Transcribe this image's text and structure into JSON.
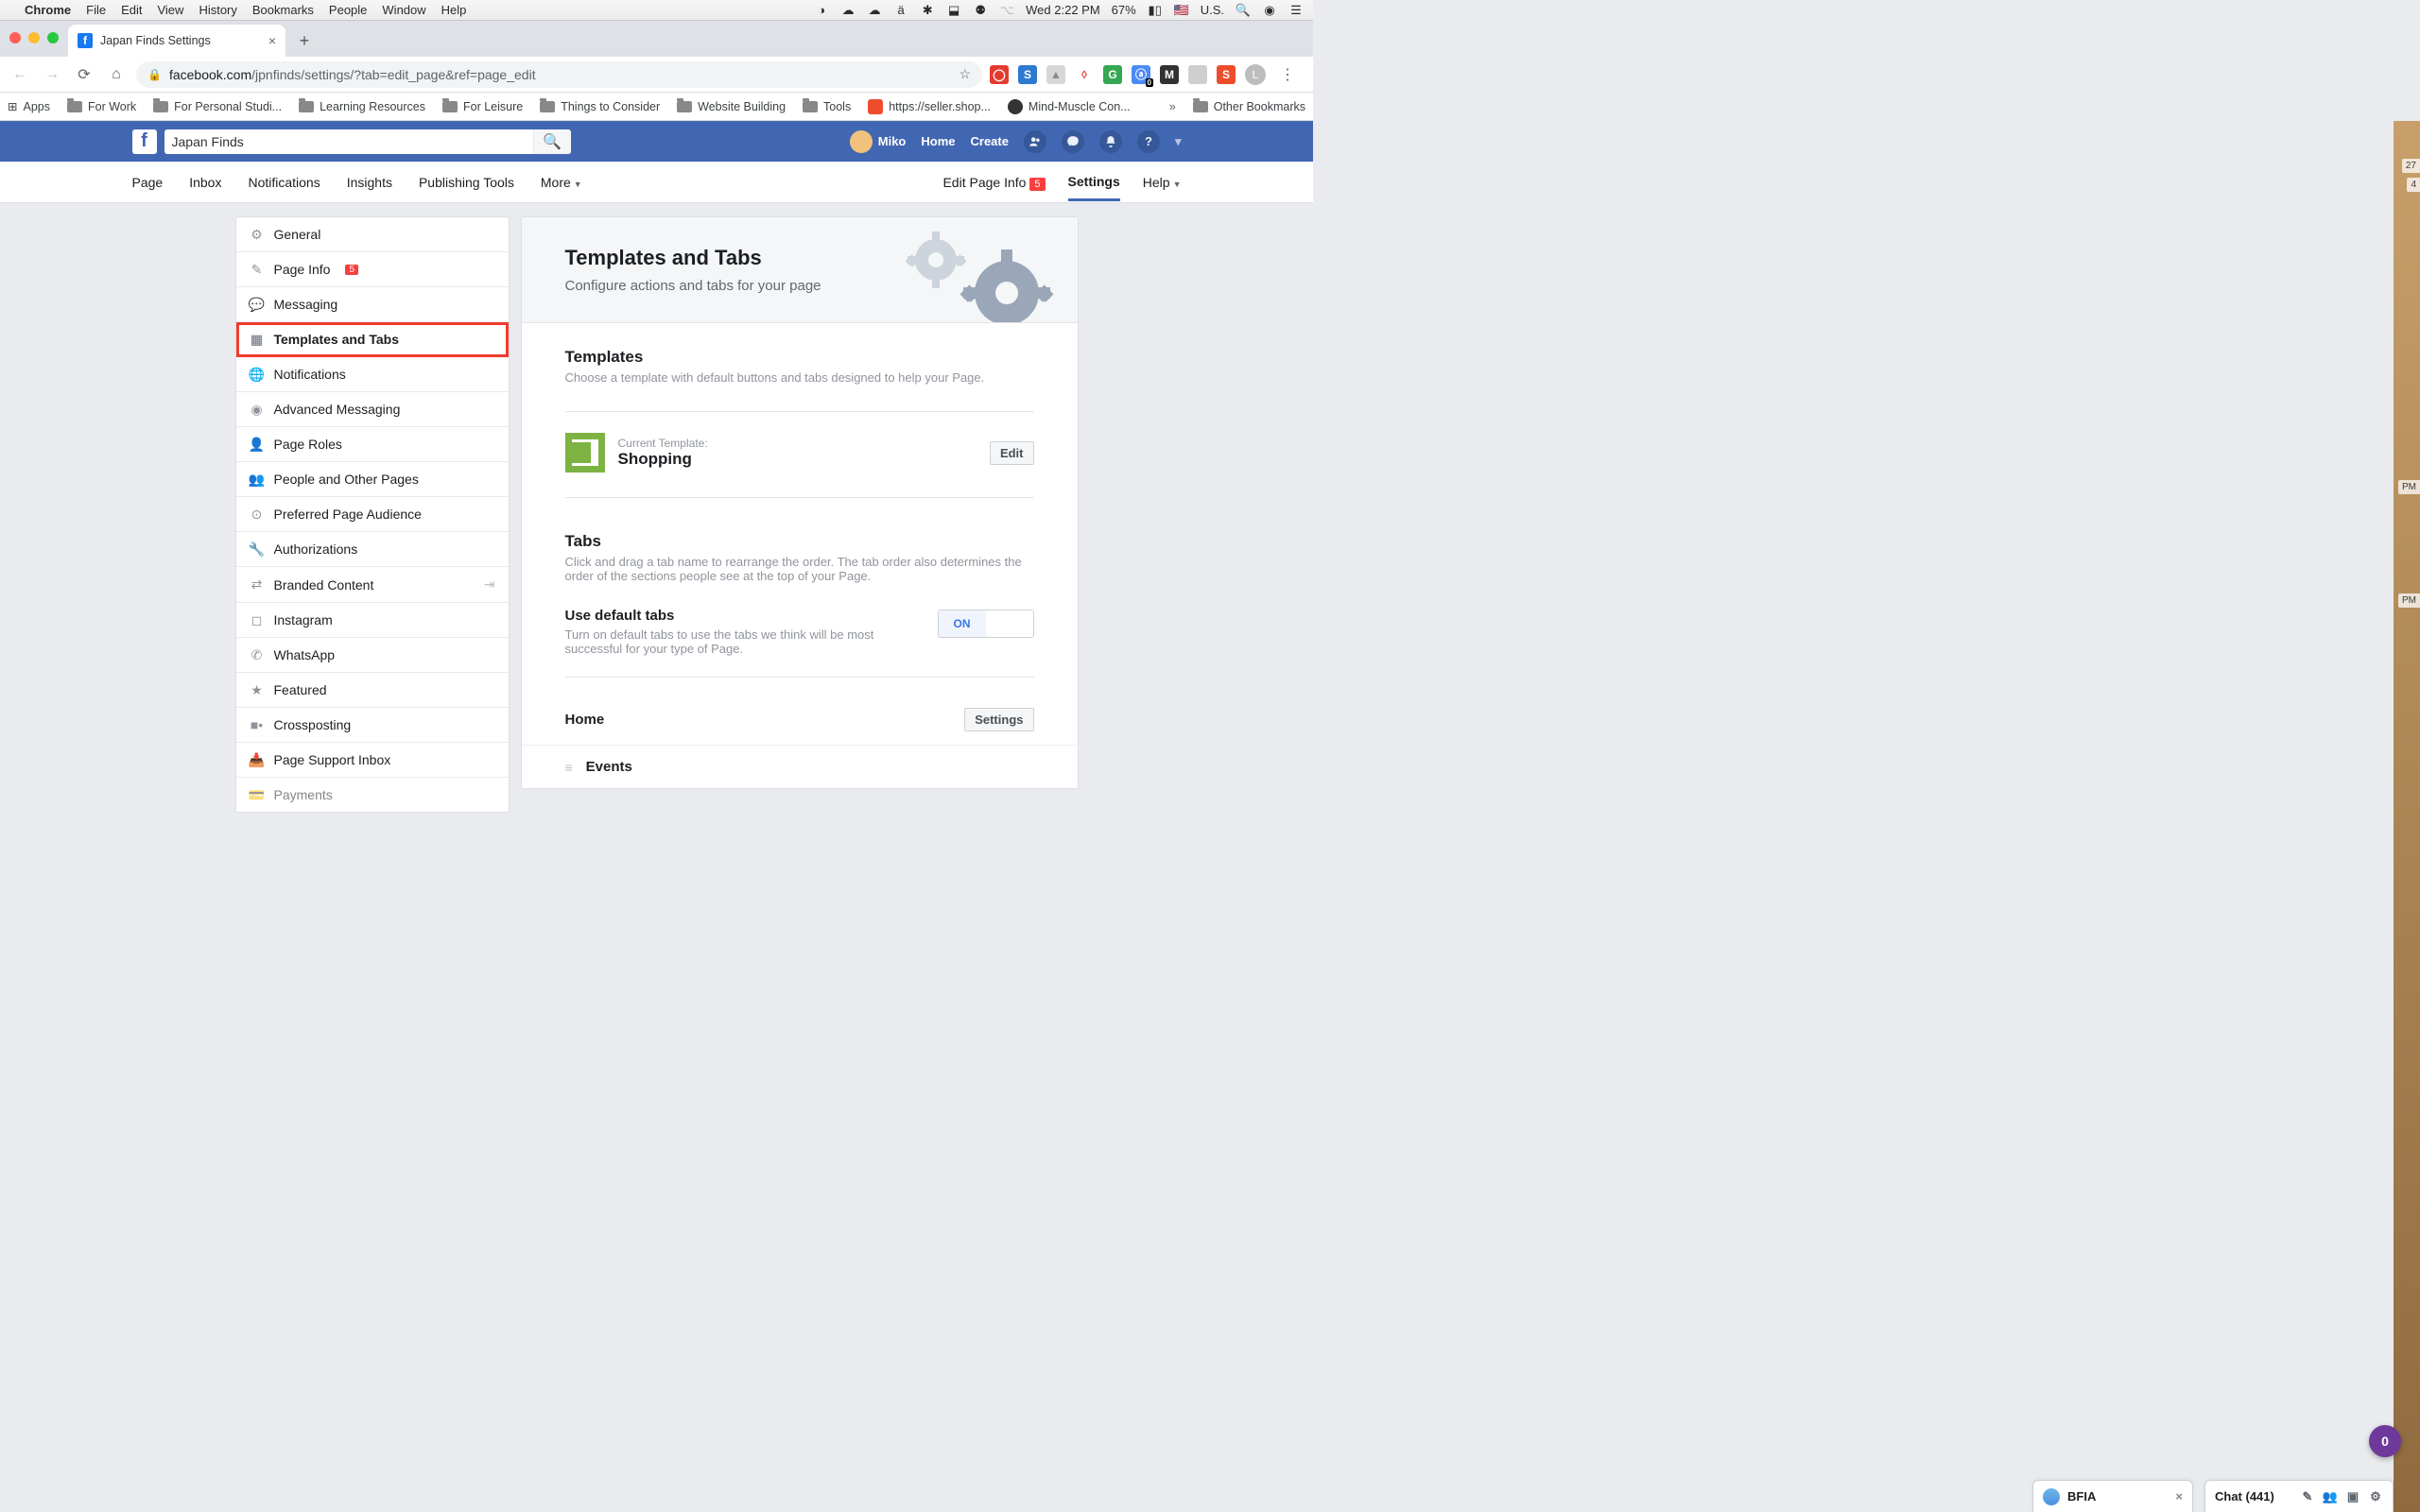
{
  "mac": {
    "app": "Chrome",
    "menu": [
      "File",
      "Edit",
      "View",
      "History",
      "Bookmarks",
      "People",
      "Window",
      "Help"
    ],
    "clock": "Wed 2:22 PM",
    "battery": "67%",
    "locale": "U.S."
  },
  "chrome": {
    "tab_title": "Japan Finds Settings",
    "url_domain": "facebook.com",
    "url_path": "/jpnfinds/settings/?tab=edit_page&ref=page_edit",
    "bookmarks": [
      "Apps",
      "For Work",
      "For Personal Studi...",
      "Learning Resources",
      "For Leisure",
      "Things to Consider",
      "Website Building",
      "Tools",
      "https://seller.shop...",
      "Mind-Muscle Con..."
    ],
    "bookmarks_more": "»",
    "other_bookmarks": "Other Bookmarks",
    "avatar_letter": "L"
  },
  "fb": {
    "search_value": "Japan Finds",
    "profile_name": "Miko",
    "nav_home": "Home",
    "nav_create": "Create"
  },
  "page_nav": {
    "items": [
      "Page",
      "Inbox",
      "Notifications",
      "Insights",
      "Publishing Tools",
      "More"
    ],
    "edit_page_info": "Edit Page Info",
    "edit_badge": "5",
    "settings": "Settings",
    "help": "Help"
  },
  "sidebar": {
    "items": [
      {
        "label": "General",
        "icon": "gear-icon"
      },
      {
        "label": "Page Info",
        "icon": "pencil-icon",
        "badge": "5"
      },
      {
        "label": "Messaging",
        "icon": "chat-icon"
      },
      {
        "label": "Templates and Tabs",
        "icon": "grid-icon",
        "selected": true
      },
      {
        "label": "Notifications",
        "icon": "globe-icon"
      },
      {
        "label": "Advanced Messaging",
        "icon": "messenger-icon"
      },
      {
        "label": "Page Roles",
        "icon": "person-icon"
      },
      {
        "label": "People and Other Pages",
        "icon": "people-icon"
      },
      {
        "label": "Preferred Page Audience",
        "icon": "audience-icon"
      },
      {
        "label": "Authorizations",
        "icon": "wrench-icon"
      },
      {
        "label": "Branded Content",
        "icon": "handshake-icon",
        "after": "↪"
      },
      {
        "label": "Instagram",
        "icon": "instagram-icon"
      },
      {
        "label": "WhatsApp",
        "icon": "whatsapp-icon"
      },
      {
        "label": "Featured",
        "icon": "star-icon"
      },
      {
        "label": "Crossposting",
        "icon": "video-icon"
      },
      {
        "label": "Page Support Inbox",
        "icon": "inbox-icon"
      },
      {
        "label": "Payments",
        "icon": "card-icon"
      }
    ]
  },
  "content": {
    "hero_title": "Templates and Tabs",
    "hero_sub": "Configure actions and tabs for your page",
    "templates_h": "Templates",
    "templates_sub": "Choose a template with default buttons and tabs designed to help your Page.",
    "current_template_label": "Current Template:",
    "current_template_value": "Shopping",
    "edit_btn": "Edit",
    "tabs_h": "Tabs",
    "tabs_sub": "Click and drag a tab name to rearrange the order. The tab order also determines the order of the sections people see at the top of your Page.",
    "default_tabs_h": "Use default tabs",
    "default_tabs_sub": "Turn on default tabs to use the tabs we think will be most successful for your type of Page.",
    "toggle_on": "ON",
    "tab_home": "Home",
    "tab_settings_btn": "Settings",
    "tab_events": "Events"
  },
  "chat": {
    "bfia": "BFIA",
    "main": "Chat (441)"
  },
  "notif_count": "0",
  "peek": {
    "a": "27",
    "b": "4",
    "c": "PM",
    "d": "PM"
  }
}
